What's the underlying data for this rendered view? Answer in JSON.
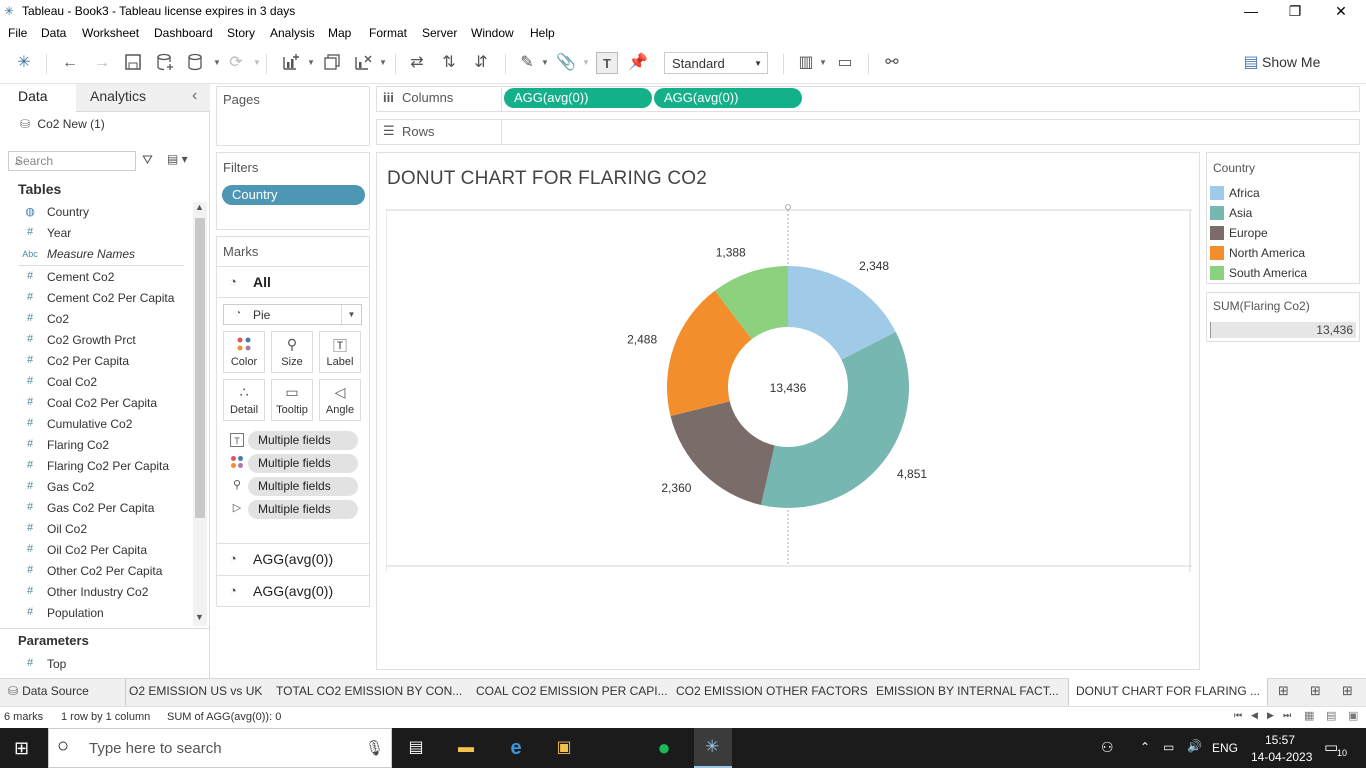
{
  "window": {
    "title": "Tableau - Book3 - Tableau license expires in 3 days"
  },
  "menu": [
    "File",
    "Data",
    "Worksheet",
    "Dashboard",
    "Story",
    "Analysis",
    "Map",
    "Format",
    "Server",
    "Window",
    "Help"
  ],
  "toolbar": {
    "fit": "Standard",
    "show_me": "Show Me"
  },
  "data_pane": {
    "tabs": [
      "Data",
      "Analytics"
    ],
    "datasource": "Co2 New (1)",
    "search_placeholder": "Search",
    "tables_header": "Tables",
    "fields": [
      {
        "type": "globe",
        "name": "Country"
      },
      {
        "type": "#",
        "name": "Year"
      },
      {
        "type": "Abc",
        "name": "Measure Names"
      },
      {
        "type": "#",
        "name": "Cement Co2"
      },
      {
        "type": "#",
        "name": "Cement Co2 Per Capita"
      },
      {
        "type": "#",
        "name": "Co2"
      },
      {
        "type": "#",
        "name": "Co2 Growth Prct"
      },
      {
        "type": "#",
        "name": "Co2 Per Capita"
      },
      {
        "type": "#",
        "name": "Coal Co2"
      },
      {
        "type": "#",
        "name": "Coal Co2 Per Capita"
      },
      {
        "type": "#",
        "name": "Cumulative Co2"
      },
      {
        "type": "#",
        "name": "Flaring Co2"
      },
      {
        "type": "#",
        "name": "Flaring Co2 Per Capita"
      },
      {
        "type": "#",
        "name": "Gas Co2"
      },
      {
        "type": "#",
        "name": "Gas Co2 Per Capita"
      },
      {
        "type": "#",
        "name": "Oil Co2"
      },
      {
        "type": "#",
        "name": "Oil Co2 Per Capita"
      },
      {
        "type": "#",
        "name": "Other Co2 Per Capita"
      },
      {
        "type": "#",
        "name": "Other Industry Co2"
      },
      {
        "type": "#",
        "name": "Population"
      }
    ],
    "parameters_header": "Parameters",
    "parameters": [
      {
        "type": "#",
        "name": "Top"
      }
    ]
  },
  "cards": {
    "pages": "Pages",
    "filters": "Filters",
    "filter_pill": "Country",
    "marks": "Marks",
    "marks_all": "All",
    "mark_type": "Pie",
    "mark_buttons": [
      "Color",
      "Size",
      "Label",
      "Detail",
      "Tooltip",
      "Angle"
    ],
    "multiple_fields": [
      "Multiple fields",
      "Multiple fields",
      "Multiple fields",
      "Multiple fields"
    ],
    "agg_rows": [
      "AGG(avg(0))",
      "AGG(avg(0))"
    ]
  },
  "shelves": {
    "columns_label": "Columns",
    "rows_label": "Rows",
    "column_pills": [
      "AGG(avg(0))",
      "AGG(avg(0))"
    ]
  },
  "view": {
    "title": "DONUT CHART FOR FLARING CO2"
  },
  "chart_data": {
    "type": "pie",
    "title": "DONUT CHART FOR FLARING CO2",
    "center_label": "13,436",
    "slices": [
      {
        "name": "Africa",
        "value": 2348,
        "label": "2,348",
        "color": "#a0cbe8"
      },
      {
        "name": "Asia",
        "value": 4851,
        "label": "4,851",
        "color": "#76b7b2"
      },
      {
        "name": "Europe",
        "value": 2360,
        "label": "2,360",
        "color": "#7a6c69"
      },
      {
        "name": "North America",
        "value": 2488,
        "label": "2,488",
        "color": "#f28e2b"
      },
      {
        "name": "South America",
        "value": 1388,
        "label": "1,388",
        "color": "#8cd17d"
      }
    ],
    "total": 13436
  },
  "legend": {
    "title": "Country",
    "items": [
      {
        "name": "Africa",
        "color": "#a0cbe8"
      },
      {
        "name": "Asia",
        "color": "#76b7b2"
      },
      {
        "name": "Europe",
        "color": "#7a6c69"
      },
      {
        "name": "North America",
        "color": "#f28e2b"
      },
      {
        "name": "South America",
        "color": "#8cd17d"
      }
    ],
    "size_title": "SUM(Flaring Co2)",
    "size_value": "13,436"
  },
  "sheet_tabs": {
    "data_source": "Data Source",
    "tabs": [
      "O2 EMISSION US vs UK",
      "TOTAL CO2 EMISSION BY CON...",
      "COAL CO2 EMISSION PER CAPI...",
      "CO2 EMISSION OTHER FACTORS",
      "EMISSION BY INTERNAL FACT...",
      "DONUT CHART FOR FLARING ..."
    ]
  },
  "status": {
    "marks": "6 marks",
    "dims": "1 row by 1 column",
    "sum": "SUM of AGG(avg(0)): 0"
  },
  "taskbar": {
    "search_placeholder": "Type here to search",
    "lang": "ENG",
    "time": "15:57",
    "date": "14-04-2023",
    "notif": "10"
  },
  "colors": {
    "accent_green": "#13b08a",
    "filter_pill": "#4e97b4"
  }
}
